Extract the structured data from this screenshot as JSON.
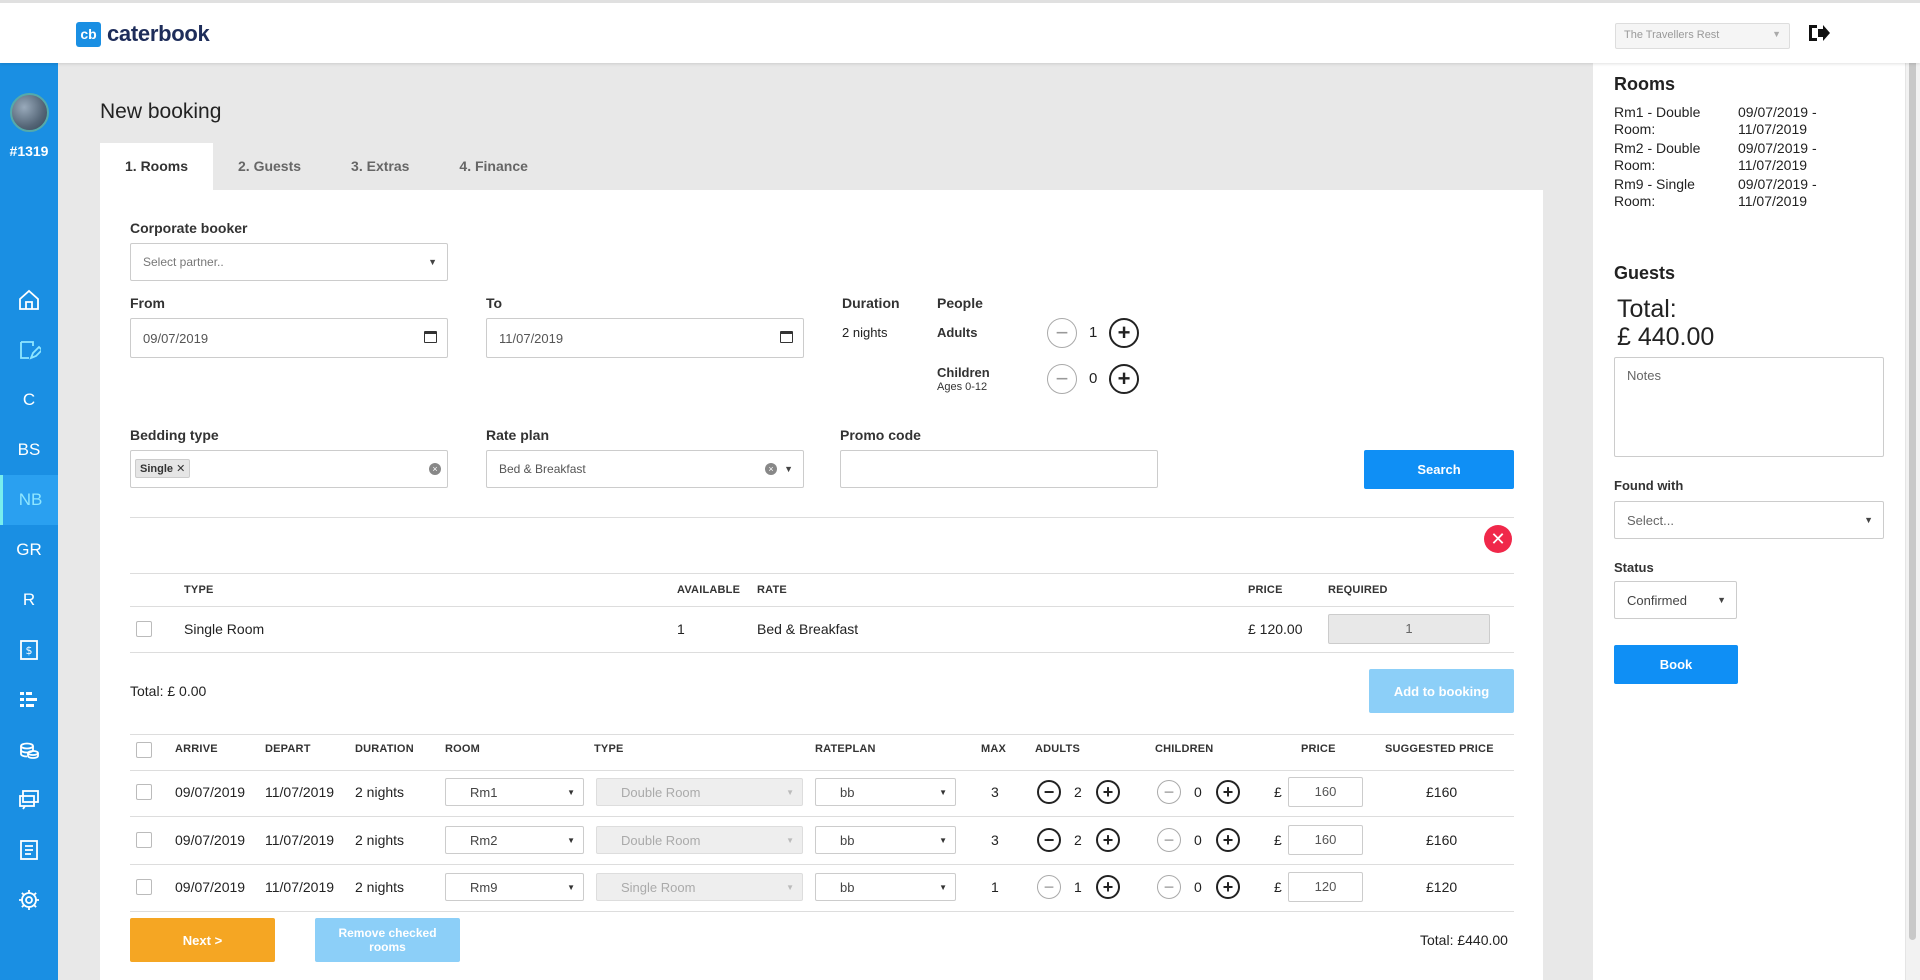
{
  "header": {
    "brand_mark": "cb",
    "brand_name": "caterbook",
    "venue": "The Travellers Rest",
    "logout_icon": "sign-out-icon"
  },
  "sidebar": {
    "account": "#1319",
    "items": [
      {
        "icon": "home-icon"
      },
      {
        "icon": "edit-icon"
      },
      {
        "label": "C"
      },
      {
        "label": "BS"
      },
      {
        "label": "NB"
      },
      {
        "label": "GR"
      },
      {
        "label": "R"
      },
      {
        "icon": "invoice-icon"
      },
      {
        "icon": "gantt-icon"
      },
      {
        "icon": "coins-icon"
      },
      {
        "icon": "messages-icon"
      },
      {
        "icon": "document-icon"
      },
      {
        "icon": "gear-icon"
      }
    ],
    "accent": "#1a8fe3"
  },
  "page": {
    "title": "New booking",
    "tabs": [
      "1. Rooms",
      "2. Guests",
      "3. Extras",
      "4. Finance"
    ]
  },
  "form": {
    "corporate_label": "Corporate booker",
    "corporate_placeholder": "Select partner..",
    "from_label": "From",
    "from_value": "09/07/2019",
    "to_label": "To",
    "to_value": "11/07/2019",
    "duration_label": "Duration",
    "duration_value": "2 nights",
    "people_label": "People",
    "adults_label": "Adults",
    "adults_value": "1",
    "children_label": "Children",
    "children_sub": "Ages 0-12",
    "children_value": "0",
    "bedding_label": "Bedding type",
    "bedding_tag": "Single",
    "rate_label": "Rate plan",
    "rate_value": "Bed & Breakfast",
    "promo_label": "Promo code",
    "promo_value": "",
    "search_label": "Search"
  },
  "availability": {
    "headers": {
      "type": "TYPE",
      "available": "AVAILABLE",
      "rate": "RATE",
      "price": "PRICE",
      "required": "REQUIRED"
    },
    "rows": [
      {
        "type": "Single Room",
        "available": "1",
        "rate": "Bed & Breakfast",
        "price": "£ 120.00",
        "required": "1"
      }
    ],
    "total": "Total: £ 0.00",
    "add_label": "Add to booking"
  },
  "booking": {
    "headers": {
      "arrive": "ARRIVE",
      "depart": "DEPART",
      "duration": "DURATION",
      "room": "ROOM",
      "type": "TYPE",
      "rateplan": "RATEPLAN",
      "max": "MAX",
      "adults": "ADULTS",
      "children": "CHILDREN",
      "price": "PRICE",
      "suggested": "SUGGESTED PRICE"
    },
    "currency": "£",
    "rows": [
      {
        "arrive": "09/07/2019",
        "depart": "11/07/2019",
        "duration": "2 nights",
        "room": "Rm1",
        "type": "Double Room",
        "rateplan": "bb",
        "max": "3",
        "adults": "2",
        "children": "0",
        "price": "160",
        "suggested": "£160"
      },
      {
        "arrive": "09/07/2019",
        "depart": "11/07/2019",
        "duration": "2 nights",
        "room": "Rm2",
        "type": "Double Room",
        "rateplan": "bb",
        "max": "3",
        "adults": "2",
        "children": "0",
        "price": "160",
        "suggested": "£160"
      },
      {
        "arrive": "09/07/2019",
        "depart": "11/07/2019",
        "duration": "2 nights",
        "room": "Rm9",
        "type": "Single Room",
        "rateplan": "bb",
        "max": "1",
        "adults": "1",
        "children": "0",
        "price": "120",
        "suggested": "£120"
      }
    ],
    "next_label": "Next >",
    "remove_label": "Remove checked rooms",
    "total": "Total: £440.00"
  },
  "summary": {
    "rooms_heading": "Rooms",
    "rooms": [
      {
        "name": "Rm1 - Double Room:",
        "dates": "09/07/2019 - 11/07/2019"
      },
      {
        "name": "Rm2 - Double Room:",
        "dates": "09/07/2019 - 11/07/2019"
      },
      {
        "name": "Rm9 - Single Room:",
        "dates": "09/07/2019 - 11/07/2019"
      }
    ],
    "guests_heading": "Guests",
    "total_label": "Total:",
    "total_value": "£ 440.00",
    "notes_placeholder": "Notes",
    "found_label": "Found with",
    "found_placeholder": "Select...",
    "status_label": "Status",
    "status_value": "Confirmed",
    "book_label": "Book"
  }
}
